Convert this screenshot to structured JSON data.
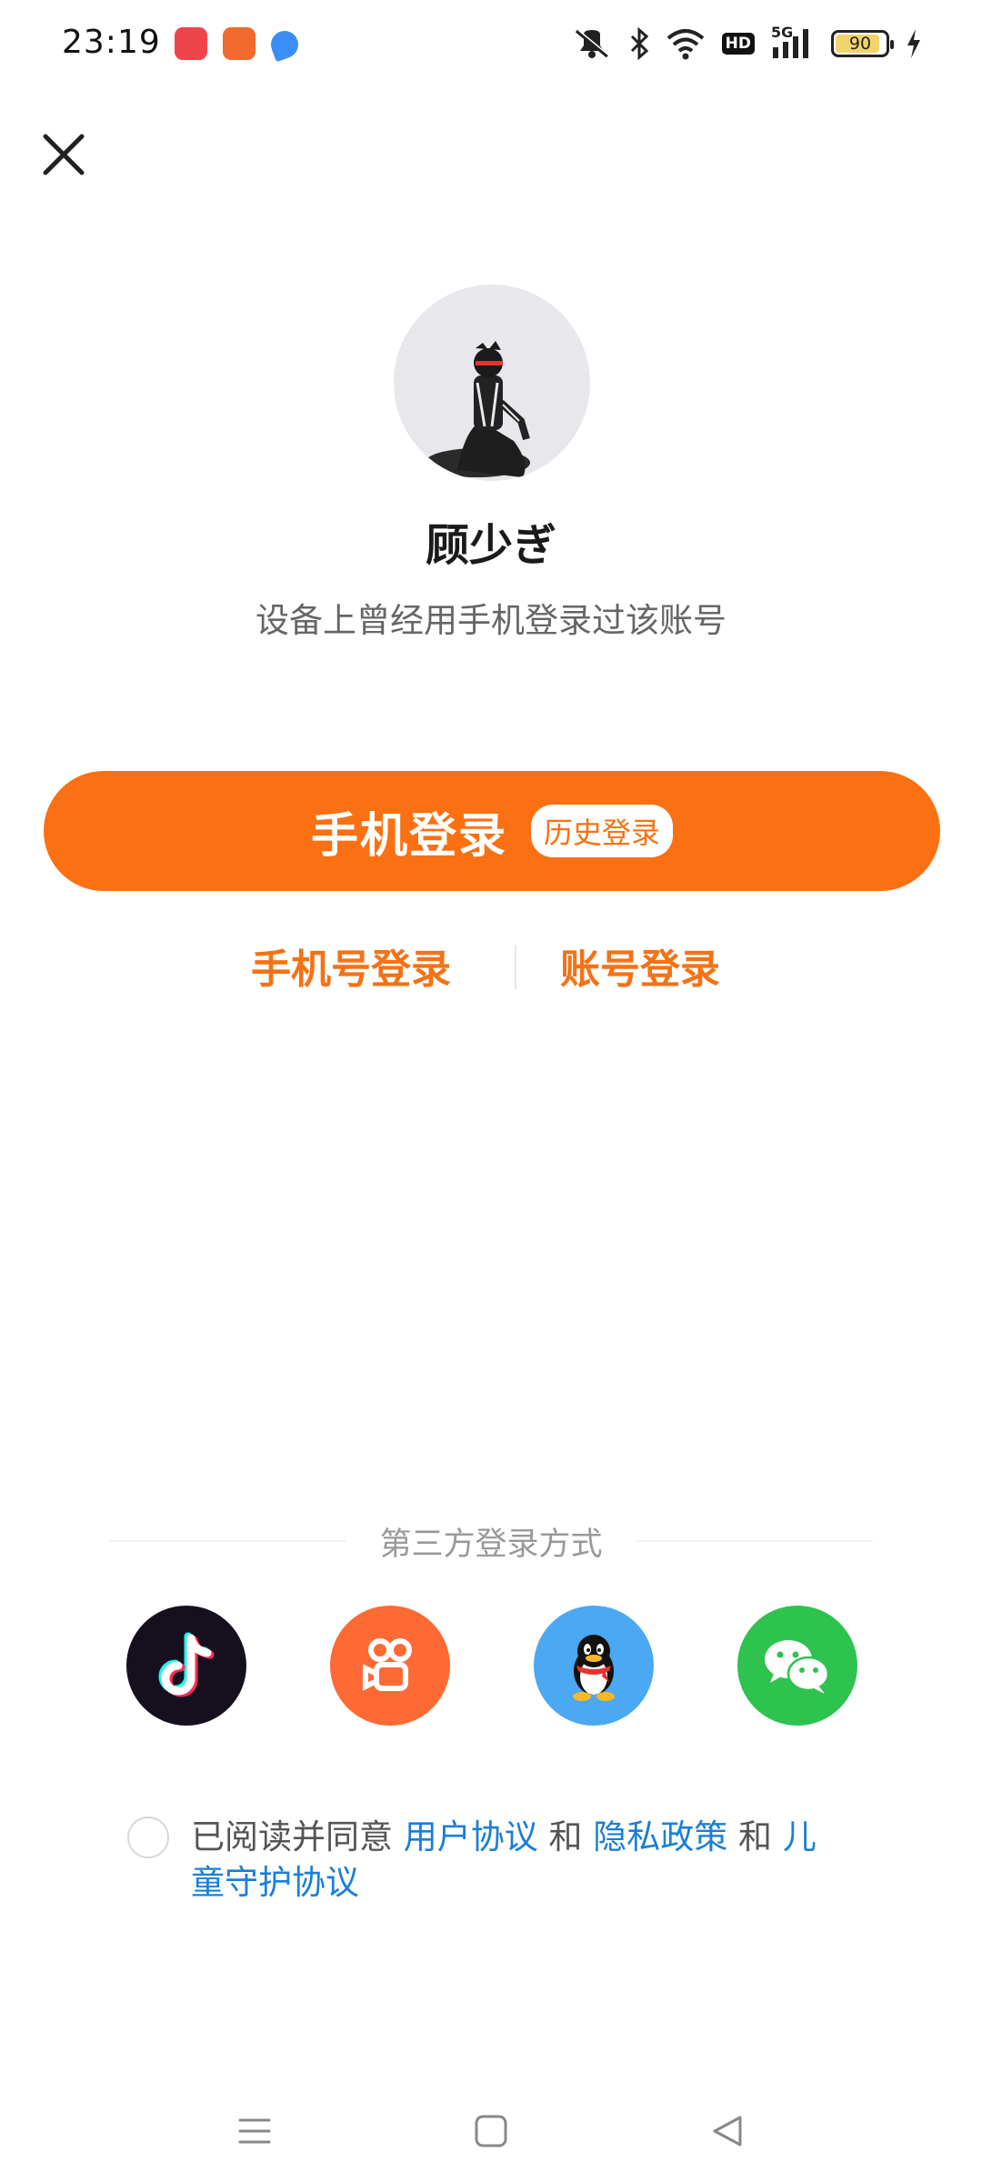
{
  "status_bar": {
    "time": "23:19",
    "app_badges": [
      "douyin-app-icon",
      "kuaishou-app-icon",
      "feather-app-icon"
    ],
    "network_label": "5G",
    "hd_label": "HD",
    "battery_percent": 90,
    "battery_label": "90",
    "icons": [
      "mute-icon",
      "bluetooth-icon",
      "wifi-icon",
      "hd-icon",
      "signal-icon",
      "battery-icon",
      "charging-icon"
    ]
  },
  "header": {
    "close_icon": "close-icon"
  },
  "profile": {
    "username": "顾少ぎ",
    "hint": "设备上曾经用手机登录过该账号"
  },
  "primary_login": {
    "label": "手机登录",
    "badge": "历史登录"
  },
  "alt_login": {
    "phone_number_label": "手机号登录",
    "account_label": "账号登录"
  },
  "third_party": {
    "title": "第三方登录方式",
    "providers": [
      {
        "name": "douyin",
        "icon": "douyin-icon",
        "color": "#16101e"
      },
      {
        "name": "kuaishou",
        "icon": "kuaishou-icon",
        "color": "#fe6a34"
      },
      {
        "name": "qq",
        "icon": "qq-icon",
        "color": "#4ba8f2"
      },
      {
        "name": "wechat",
        "icon": "wechat-icon",
        "color": "#2ec24f"
      }
    ]
  },
  "agreement": {
    "checked": false,
    "prefix": "已阅读并同意 ",
    "user_agreement": "用户协议",
    "and_1": " 和 ",
    "privacy_policy": "隐私政策",
    "and_2": " 和 ",
    "child_protection": "儿童守护协议"
  },
  "nav_bar": {
    "icons": [
      "menu-icon",
      "home-icon",
      "back-icon"
    ]
  },
  "colors": {
    "accent": "#fb7012",
    "link": "#1a7fd6",
    "hint_text": "#666666",
    "third_party_title": "#999999"
  }
}
